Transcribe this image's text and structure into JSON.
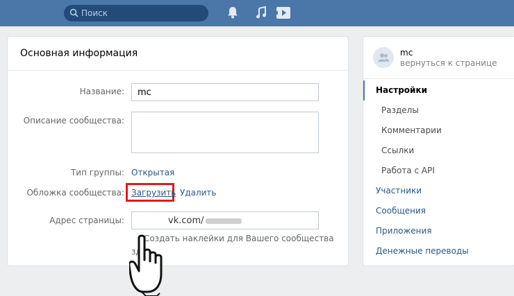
{
  "header": {
    "search_placeholder": "Поиск",
    "icons": [
      "bell-icon",
      "music-icon",
      "video-icon"
    ]
  },
  "main": {
    "title": "Основная информация",
    "name_label": "Название:",
    "name_value": "mc",
    "description_label": "Описание сообщества:",
    "description_value": "",
    "type_label": "Тип группы:",
    "type_value": "Открытая",
    "cover_label": "Обложка сообщества:",
    "cover_upload": "Загрузить",
    "cover_delete": "Удалить",
    "address_label": "Адрес страницы:",
    "address_value": "vk.com/",
    "hint": "Создать наклейки для Вашего сообщества",
    "hint_cont": "зд"
  },
  "sidebar": {
    "group_name": "mc",
    "back_link": "вернуться к странице",
    "items": [
      {
        "label": "Настройки",
        "level": "top",
        "active": true
      },
      {
        "label": "Разделы",
        "level": "sub",
        "active": false
      },
      {
        "label": "Комментарии",
        "level": "sub",
        "active": false
      },
      {
        "label": "Ссылки",
        "level": "sub",
        "active": false
      },
      {
        "label": "Работа с API",
        "level": "sub",
        "active": false
      },
      {
        "label": "Участники",
        "level": "top",
        "active": false
      },
      {
        "label": "Сообщения",
        "level": "top",
        "active": false
      },
      {
        "label": "Приложения",
        "level": "top",
        "active": false
      },
      {
        "label": "Денежные переводы",
        "level": "top",
        "active": false
      }
    ]
  },
  "colors": {
    "header": "#4a76a8",
    "link": "#2a5885",
    "highlight": "#e01b1b"
  }
}
